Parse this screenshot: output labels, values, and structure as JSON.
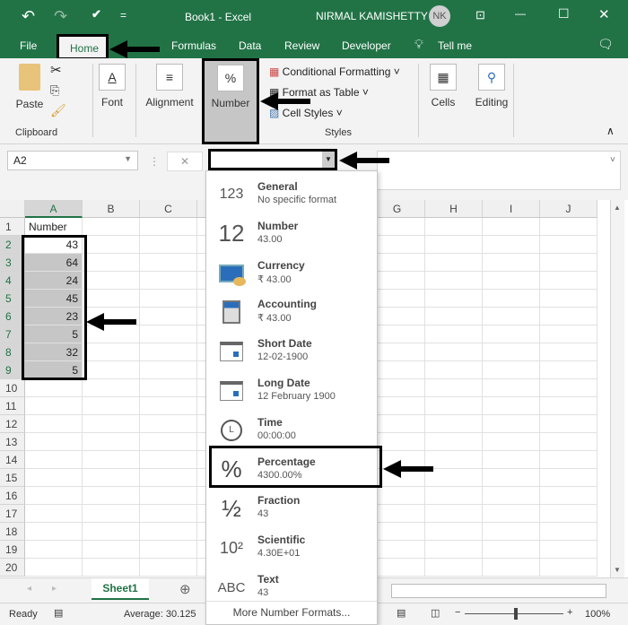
{
  "title": {
    "doc": "Book1  -  Excel",
    "user": "NIRMAL KAMISHETTY",
    "initials": "NK"
  },
  "tabs": [
    "File",
    "Home",
    "Formulas",
    "Data",
    "Review",
    "Developer",
    "Tell me"
  ],
  "ribbon": {
    "paste": "Paste",
    "clipboard": "Clipboard",
    "font": "Font",
    "alignment": "Alignment",
    "number": "Number",
    "conditional": "Conditional Formatting",
    "format_table": "Format as Table",
    "cell_styles": "Cell Styles",
    "styles": "Styles",
    "cells": "Cells",
    "editing": "Editing"
  },
  "namebox": "A2",
  "columns": [
    "A",
    "B",
    "C",
    "D",
    "E",
    "F",
    "G",
    "H",
    "I",
    "J"
  ],
  "rows": [
    "1",
    "2",
    "3",
    "4",
    "5",
    "6",
    "7",
    "8",
    "9",
    "10",
    "11",
    "12",
    "13",
    "14",
    "15",
    "16",
    "17",
    "18",
    "19",
    "20"
  ],
  "cells": {
    "A1": "Number",
    "values": [
      "43",
      "64",
      "24",
      "45",
      "23",
      "5",
      "32",
      "5"
    ]
  },
  "number_menu": [
    {
      "title": "General",
      "sample": "No specific format",
      "icon": "123-clock-icon"
    },
    {
      "title": "Number",
      "sample": "43.00",
      "icon": "12-icon"
    },
    {
      "title": "Currency",
      "sample": "₹ 43.00",
      "icon": "currency-icon"
    },
    {
      "title": "Accounting",
      "sample": " ₹ 43.00",
      "icon": "accounting-icon"
    },
    {
      "title": "Short Date",
      "sample": "12-02-1900",
      "icon": "calendar-icon"
    },
    {
      "title": "Long Date",
      "sample": "12 February 1900",
      "icon": "calendar-icon"
    },
    {
      "title": "Time",
      "sample": "00:00:00",
      "icon": "clock-icon"
    },
    {
      "title": "Percentage",
      "sample": "4300.00%",
      "icon": "percent-icon"
    },
    {
      "title": "Fraction",
      "sample": "43",
      "icon": "fraction-icon"
    },
    {
      "title": "Scientific",
      "sample": "4.30E+01",
      "icon": "scientific-icon"
    },
    {
      "title": "Text",
      "sample": "43",
      "icon": "abc-icon"
    }
  ],
  "icon_glyphs": {
    "general": "123",
    "number": "12",
    "percent": "%",
    "fraction": "½",
    "scientific": "10²",
    "text": "ABC"
  },
  "more_formats": "More Number Formats...",
  "sheet": "Sheet1",
  "status": {
    "ready": "Ready",
    "average": "Average: 30.125",
    "zoom": "100%"
  },
  "colors": {
    "accent": "#217346"
  }
}
